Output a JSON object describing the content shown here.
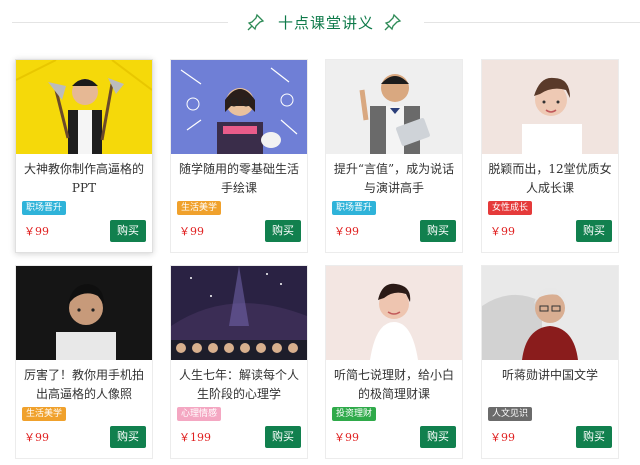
{
  "section": {
    "title": "十点课堂讲义",
    "pin_icon": "pushpin-icon",
    "accent": "#0e7a4a"
  },
  "buy_color": "#11804e",
  "price_color": "#e02020",
  "courses": [
    {
      "title": "大神教你制作高逼格的PPT",
      "tag": "职场晋升",
      "tag_color": "#2fb3d9",
      "price": "￥99",
      "buy": "购买"
    },
    {
      "title": "随学随用的零基础生活手绘课",
      "tag": "生活美学",
      "tag_color": "#f0a12c",
      "price": "￥99",
      "buy": "购买"
    },
    {
      "title": "提升“言值”，成为说话与演讲高手",
      "tag": "职场晋升",
      "tag_color": "#2fb3d9",
      "price": "￥99",
      "buy": "购买"
    },
    {
      "title": "脱颖而出，12堂优质女人成长课",
      "tag": "女性成长",
      "tag_color": "#e53a3a",
      "price": "￥99",
      "buy": "购买"
    },
    {
      "title": "厉害了！教你用手机拍出高逼格的人像照",
      "tag": "生活美学",
      "tag_color": "#f0a12c",
      "price": "￥99",
      "buy": "购买"
    },
    {
      "title": "人生七年：解读每个人生阶段的心理学",
      "tag": "心理情感",
      "tag_color": "#f4a7c2",
      "price": "￥199",
      "buy": "购买"
    },
    {
      "title": "听简七说理财，给小白的极简理财课",
      "tag": "投资理财",
      "tag_color": "#2faa4a",
      "price": "￥99",
      "buy": "购买"
    },
    {
      "title": "听蒋勋讲中国文学",
      "tag": "人文见识",
      "tag_color": "#6b6b6b",
      "price": "￥99",
      "buy": "购买"
    }
  ]
}
